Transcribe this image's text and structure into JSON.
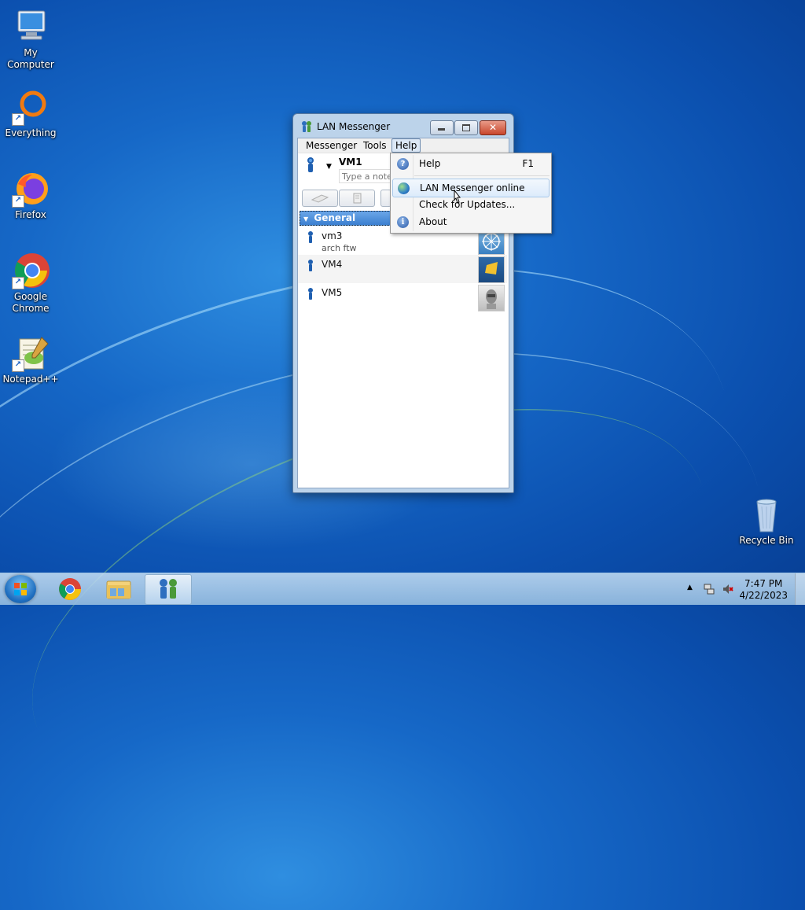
{
  "desktop": {
    "icons": [
      {
        "label": "My Computer"
      },
      {
        "label": "Everything"
      },
      {
        "label": "Firefox"
      },
      {
        "label": "Google Chrome"
      },
      {
        "label": "Notepad++"
      },
      {
        "label": "Recycle Bin"
      }
    ]
  },
  "window": {
    "title": "LAN Messenger",
    "menu": [
      "Messenger",
      "Tools",
      "Help"
    ],
    "user": {
      "name": "VM1",
      "note_placeholder": "Type a note"
    },
    "group": "General",
    "contacts": [
      {
        "name": "vm3",
        "note": "arch ftw"
      },
      {
        "name": "VM4",
        "note": ""
      },
      {
        "name": "VM5",
        "note": ""
      }
    ]
  },
  "help_menu": {
    "items": [
      {
        "label": "Help",
        "shortcut": "F1",
        "icon": "help-icon"
      },
      {
        "label": "LAN Messenger online",
        "shortcut": "",
        "icon": "globe-icon"
      },
      {
        "label": "Check for Updates...",
        "shortcut": "",
        "icon": ""
      },
      {
        "label": "About",
        "shortcut": "",
        "icon": "info-icon"
      }
    ]
  },
  "taskbar": {
    "time": "7:47 PM",
    "date": "4/22/2023"
  },
  "colors": {
    "accent": "#3b7fd0",
    "desktop": "#1668c7"
  }
}
